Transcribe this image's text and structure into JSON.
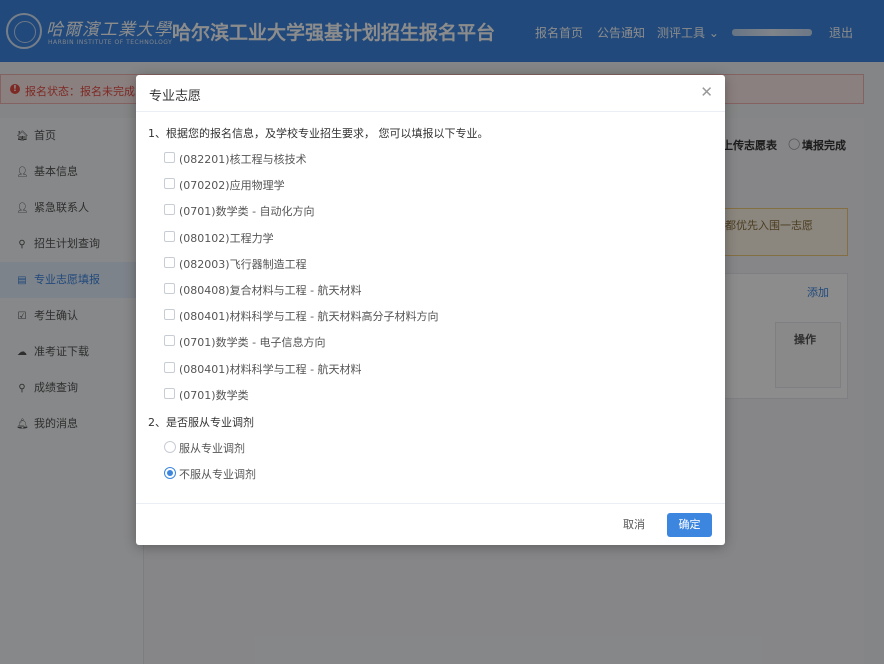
{
  "header": {
    "university_name": "哈爾濱工業大學",
    "university_en": "HARBIN INSTITUTE OF TECHNOLOGY",
    "site_title": "哈尔滨工业大学强基计划招生报名平台",
    "nav": [
      "报名首页",
      "公告通知",
      "测评工具 ⌄",
      "退出"
    ]
  },
  "status_bar": {
    "text": "报名状态：报名未完成"
  },
  "sidebar": {
    "items": [
      {
        "icon": "home-icon",
        "glyph": "🏠︎",
        "label": "首页",
        "active": false
      },
      {
        "icon": "user-icon",
        "glyph": "👤︎",
        "label": "基本信息",
        "active": false
      },
      {
        "icon": "user-icon",
        "glyph": "👤︎",
        "label": "紧急联系人",
        "active": false
      },
      {
        "icon": "search-icon",
        "glyph": "⚲",
        "label": "招生计划查询",
        "active": false
      },
      {
        "icon": "list-icon",
        "glyph": "▤",
        "label": "专业志愿填报",
        "active": true
      },
      {
        "icon": "check-icon",
        "glyph": "☑",
        "label": "考生确认",
        "active": false
      },
      {
        "icon": "cloud-download-icon",
        "glyph": "☁",
        "label": "准考证下载",
        "active": false
      },
      {
        "icon": "search-icon",
        "glyph": "⚲",
        "label": "成绩查询",
        "active": false
      },
      {
        "icon": "bell-icon",
        "glyph": "🔔︎",
        "label": "我的消息",
        "active": false
      }
    ]
  },
  "background": {
    "steps": [
      "上传志愿表",
      "填报完成"
    ],
    "notice": "都优先入围一志愿",
    "add_label": "添加",
    "table_header": "操作"
  },
  "modal": {
    "title": "专业志愿",
    "q1": "1、根据您的报名信息，及学校专业招生要求， 您可以填报以下专业。",
    "majors": [
      {
        "label": "(082201)核工程与核技术",
        "checked": false
      },
      {
        "label": "(070202)应用物理学",
        "checked": false
      },
      {
        "label": "(0701)数学类 - 自动化方向",
        "checked": false
      },
      {
        "label": "(080102)工程力学",
        "checked": false
      },
      {
        "label": "(082003)飞行器制造工程",
        "checked": false
      },
      {
        "label": "(080408)复合材料与工程 - 航天材料",
        "checked": false
      },
      {
        "label": "(080401)材料科学与工程 - 航天材料高分子材料方向",
        "checked": false
      },
      {
        "label": "(0701)数学类 - 电子信息方向",
        "checked": false
      },
      {
        "label": "(080401)材料科学与工程 - 航天材料",
        "checked": false
      },
      {
        "label": "(0701)数学类",
        "checked": false
      }
    ],
    "q2": "2、是否服从专业调剂",
    "adjust_options": [
      {
        "label": "服从专业调剂",
        "checked": false
      },
      {
        "label": "不服从专业调剂",
        "checked": true
      }
    ],
    "cancel_label": "取消",
    "ok_label": "确定"
  },
  "colors": {
    "primary": "#3d86e0",
    "danger": "#e54d42"
  }
}
